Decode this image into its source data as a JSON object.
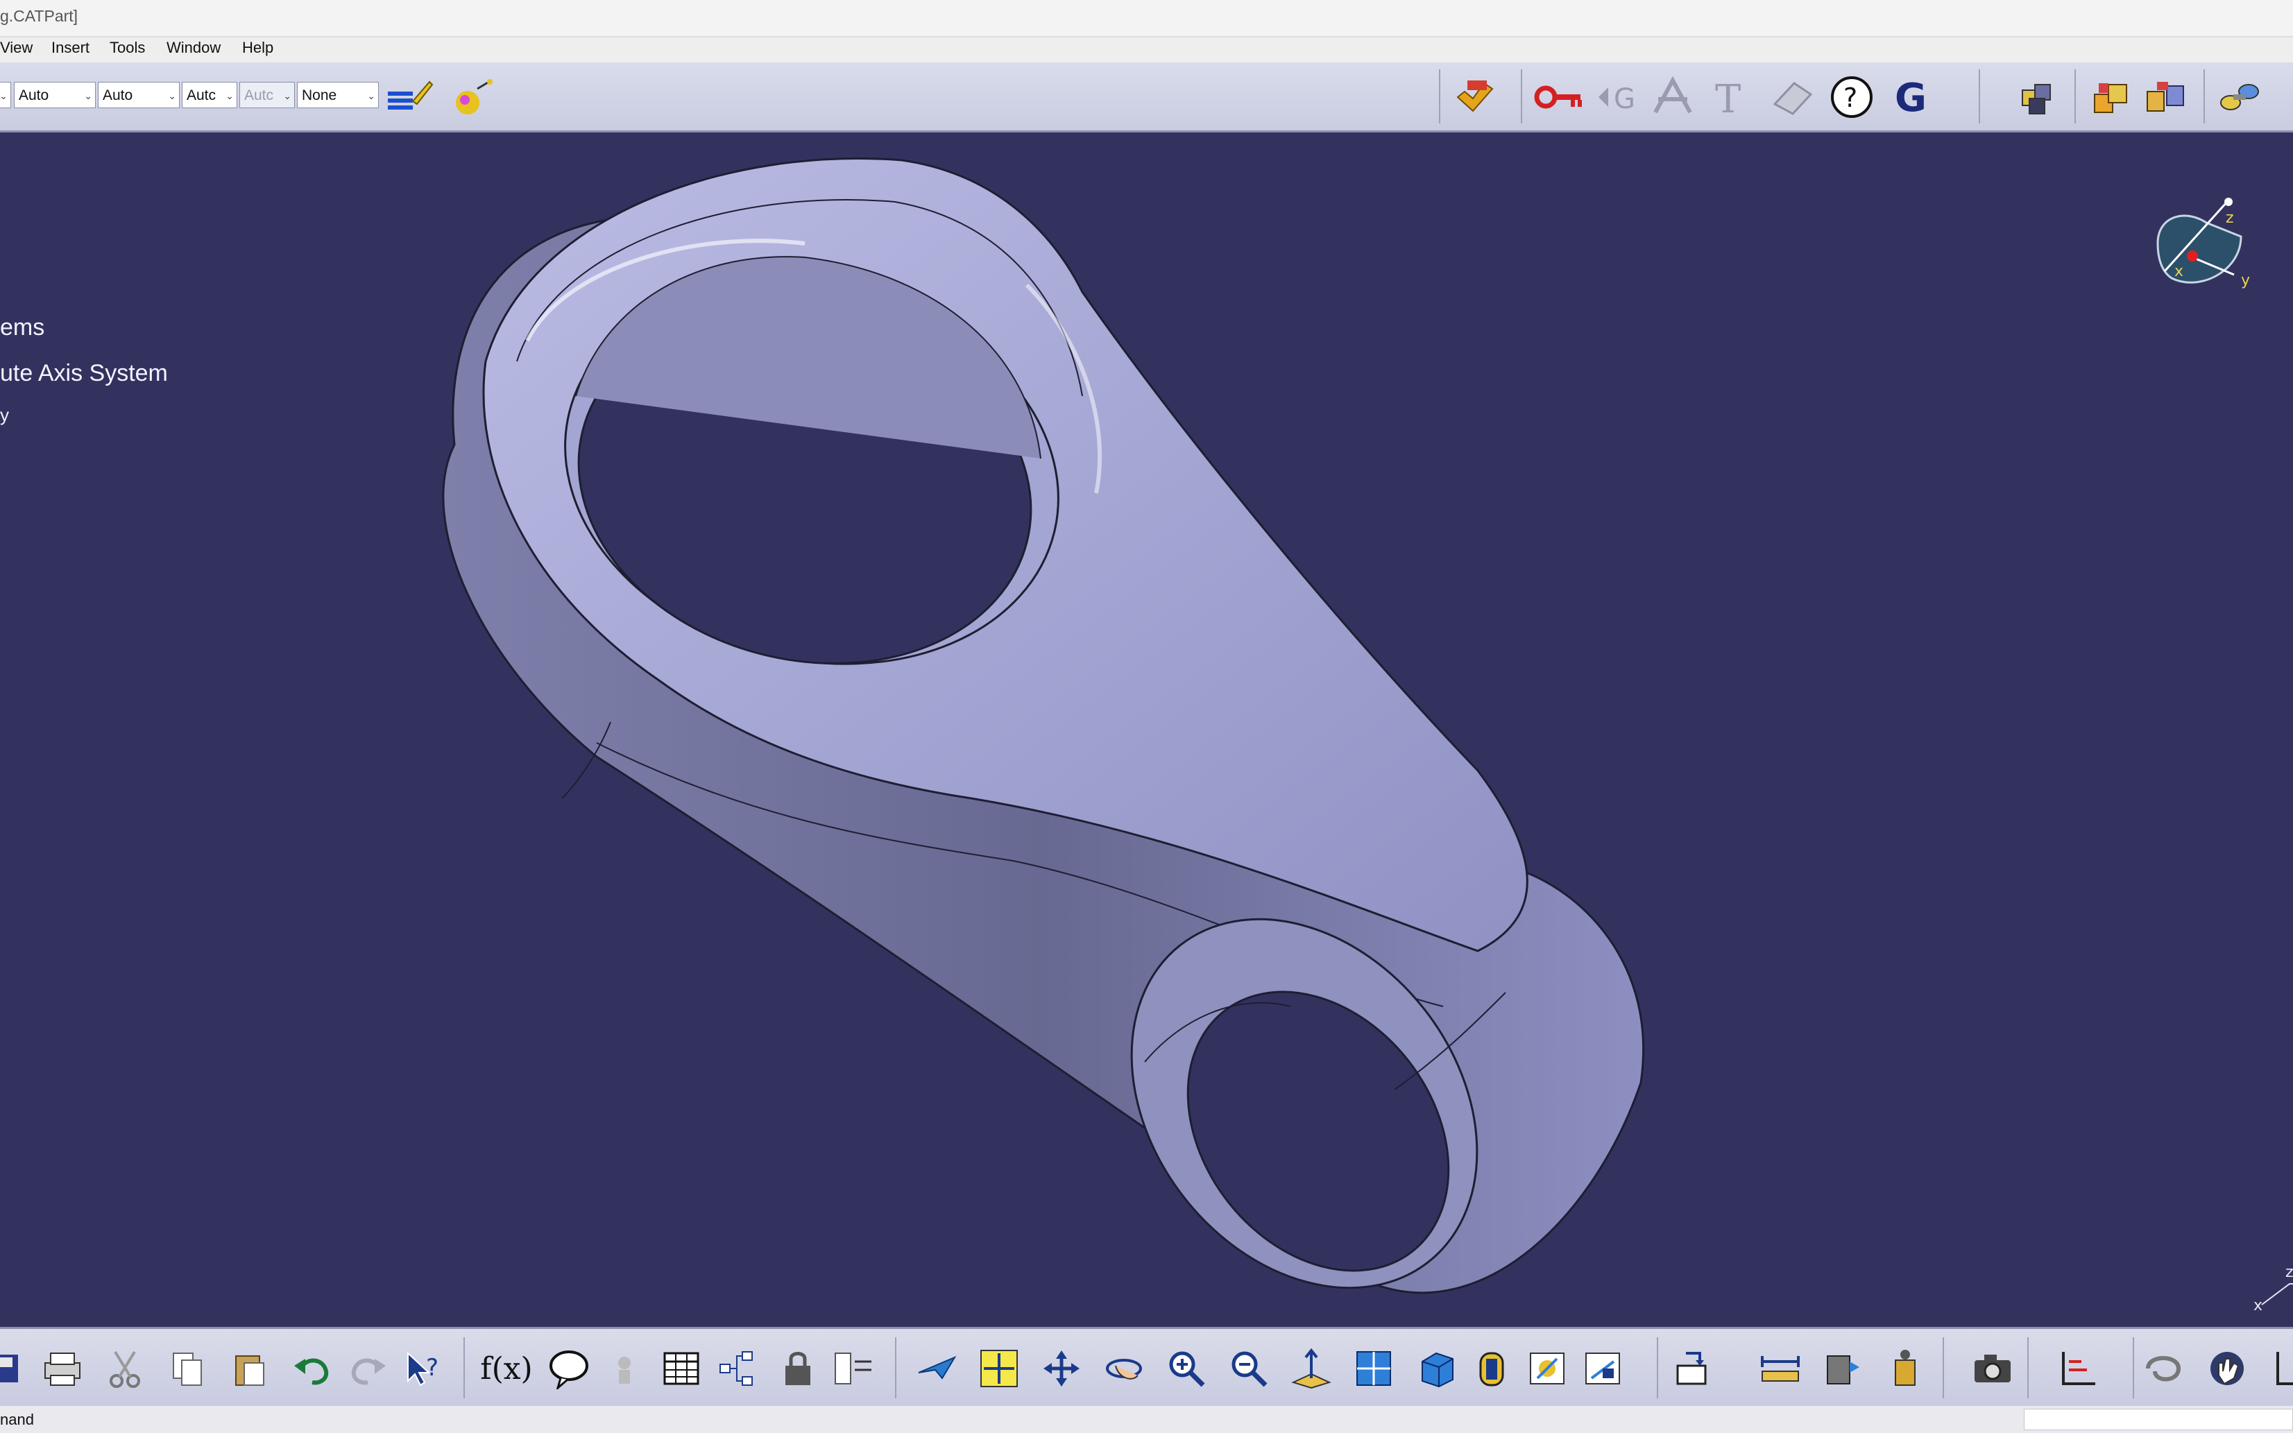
{
  "window": {
    "title": "g.CATPart]"
  },
  "menu": {
    "items": [
      "View",
      "Insert",
      "Tools",
      "Window",
      "Help"
    ]
  },
  "toolbar": {
    "combos": [
      "Auto",
      "Auto",
      "Autc",
      "Autc",
      "None"
    ],
    "icons": [
      "paint-brush-icon",
      "apply-material-icon",
      "publish-icon",
      "key-icon",
      "knowledge-icon",
      "annotation-icon",
      "text-icon",
      "eraser-icon",
      "help-icon",
      "g-icon",
      "catalog-icon",
      "boxes-icon",
      "boxes-split-icon",
      "bolts-icon"
    ]
  },
  "tree": {
    "items": [
      "ems",
      "ute Axis System",
      "y"
    ]
  },
  "compass": {
    "labels": {
      "x": "x",
      "y": "y",
      "z": "z"
    }
  },
  "axis_corner": {
    "labels": {
      "x": "x",
      "z": "z"
    }
  },
  "bottom_toolbar": {
    "icons": [
      "save-icon",
      "print-icon",
      "cut-icon",
      "copy-icon",
      "paste-icon",
      "undo-icon",
      "redo-icon",
      "whats-this-icon",
      "formula-icon",
      "comment-icon",
      "shield-icon",
      "table-icon",
      "hierarchy-icon",
      "lock-icon",
      "list-icon",
      "fly-icon",
      "fit-all-icon",
      "pan-icon",
      "rotate-icon",
      "zoom-in-icon",
      "zoom-out-icon",
      "normal-view-icon",
      "multi-view-icon",
      "iso-view-icon",
      "render-style-icon",
      "hide-show-icon",
      "swap-icon",
      "analysis-icon",
      "measure-icon",
      "inertia-icon",
      "mass-icon",
      "capture-icon",
      "axis-icon",
      "refresh-icon",
      "hand-icon",
      "ruler-icon"
    ],
    "formula_text": "f(x)"
  },
  "status": {
    "text": "nand"
  },
  "colors": {
    "background": "#33325f",
    "part": "#a8a9d4",
    "toolbar": "#d3d6e8"
  }
}
